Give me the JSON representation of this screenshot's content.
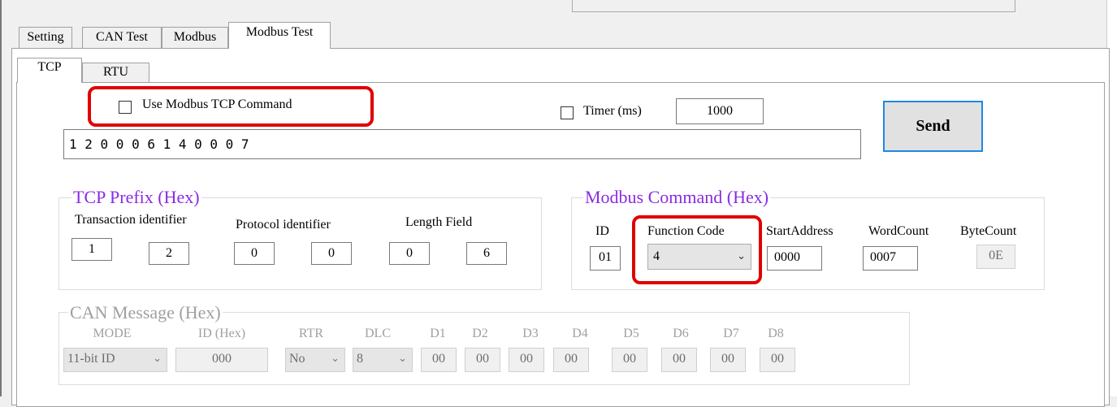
{
  "tabs": [
    "Setting",
    "CAN Test",
    "Modbus",
    "Modbus Test"
  ],
  "subtabs": [
    "TCP",
    "RTU"
  ],
  "use_modbus_tcp_label": "Use Modbus TCP Command",
  "timer_label": "Timer (ms)",
  "timer_value": "1000",
  "send_label": "Send",
  "command_value": "1 2 0 0 0 6 1 4 0 0 0 7",
  "tcp_prefix": {
    "title": "TCP Prefix (Hex)",
    "transaction_label": "Transaction identifier",
    "protocol_label": "Protocol identifier",
    "length_label": "Length Field",
    "values": [
      "1",
      "2",
      "0",
      "0",
      "0",
      "6"
    ]
  },
  "modbus_cmd": {
    "title": "Modbus Command (Hex)",
    "id_label": "ID",
    "fc_label": "Function Code",
    "start_label": "StartAddress",
    "word_label": "WordCount",
    "byte_label": "ByteCount",
    "id_value": "01",
    "fc_value": "4",
    "start_value": "0000",
    "word_value": "0007",
    "byte_value": "0E"
  },
  "can_msg": {
    "title": "CAN Message (Hex)",
    "labels": [
      "MODE",
      "ID (Hex)",
      "RTR",
      "DLC",
      "D1",
      "D2",
      "D3",
      "D4",
      "D5",
      "D6",
      "D7",
      "D8"
    ],
    "mode_value": "11-bit ID",
    "id_value": "000",
    "rtr_value": "No",
    "dlc_value": "8",
    "data_values": [
      "00",
      "00",
      "00",
      "00",
      "00",
      "00",
      "00",
      "00"
    ]
  },
  "colors": {
    "highlight": "#e00000",
    "group_title": "#8a2be2",
    "send_border": "#1e88e5"
  },
  "icons": {
    "dropdown": "chevron-down-icon"
  }
}
